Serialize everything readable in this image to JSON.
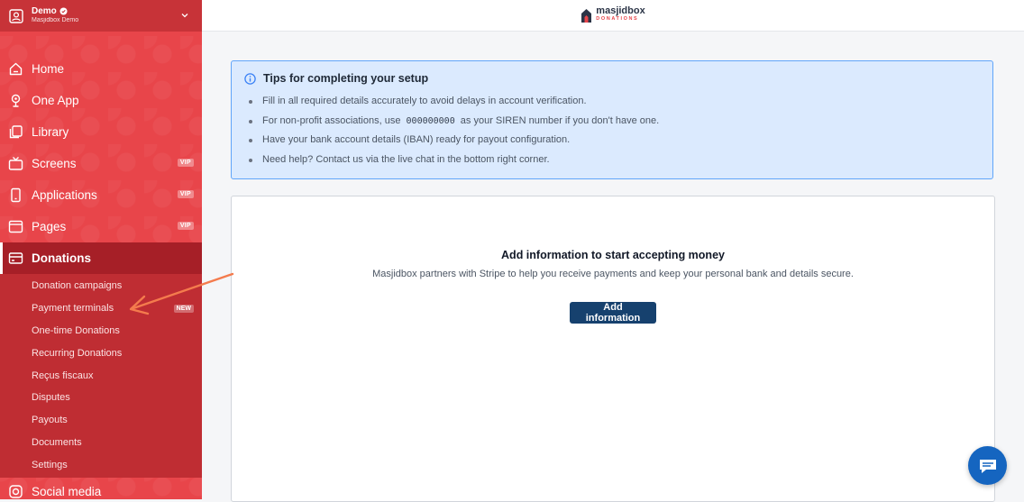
{
  "account": {
    "name": "Demo",
    "subtitle": "Masjidbox Demo"
  },
  "nav": [
    {
      "label": "Home",
      "icon": "home-icon"
    },
    {
      "label": "One App",
      "icon": "app-icon"
    },
    {
      "label": "Library",
      "icon": "library-icon"
    },
    {
      "label": "Screens",
      "icon": "tv-icon",
      "badge": "VIP"
    },
    {
      "label": "Applications",
      "icon": "phone-icon",
      "badge": "VIP"
    },
    {
      "label": "Pages",
      "icon": "browser-icon",
      "badge": "VIP"
    },
    {
      "label": "Donations",
      "icon": "card-icon",
      "active": true
    }
  ],
  "donations_sub": [
    {
      "label": "Donation campaigns"
    },
    {
      "label": "Payment terminals",
      "badge": "NEW"
    },
    {
      "label": "One-time Donations"
    },
    {
      "label": "Recurring Donations"
    },
    {
      "label": "Reçus fiscaux"
    },
    {
      "label": "Disputes"
    },
    {
      "label": "Payouts"
    },
    {
      "label": "Documents"
    },
    {
      "label": "Settings"
    }
  ],
  "social": {
    "label": "Social media"
  },
  "logo": {
    "brand": "masjidbox",
    "tag": "DONATIONS"
  },
  "tips": {
    "title": "Tips for completing your setup",
    "items": [
      "Fill in all required details accurately to avoid delays in account verification.",
      "Have your bank account details (IBAN) ready for payout configuration.",
      "Need help? Contact us via the live chat in the bottom right corner."
    ],
    "siren": {
      "before": "For non-profit associations, use",
      "code": "000000000",
      "after": "as your SIREN number if you don't have one."
    }
  },
  "card": {
    "title": "Add information to start accepting money",
    "description": "Masjidbox partners with Stripe to help you receive payments and keep your personal bank and details secure.",
    "button": "Add information"
  },
  "colors": {
    "sidebar": "#e8454a",
    "active": "#a61f27",
    "primary_button": "#16416e",
    "tips_bg": "#dbeafe",
    "tips_border": "#60a5fa",
    "chat": "#1565c0",
    "arrow": "#f47b4d"
  }
}
